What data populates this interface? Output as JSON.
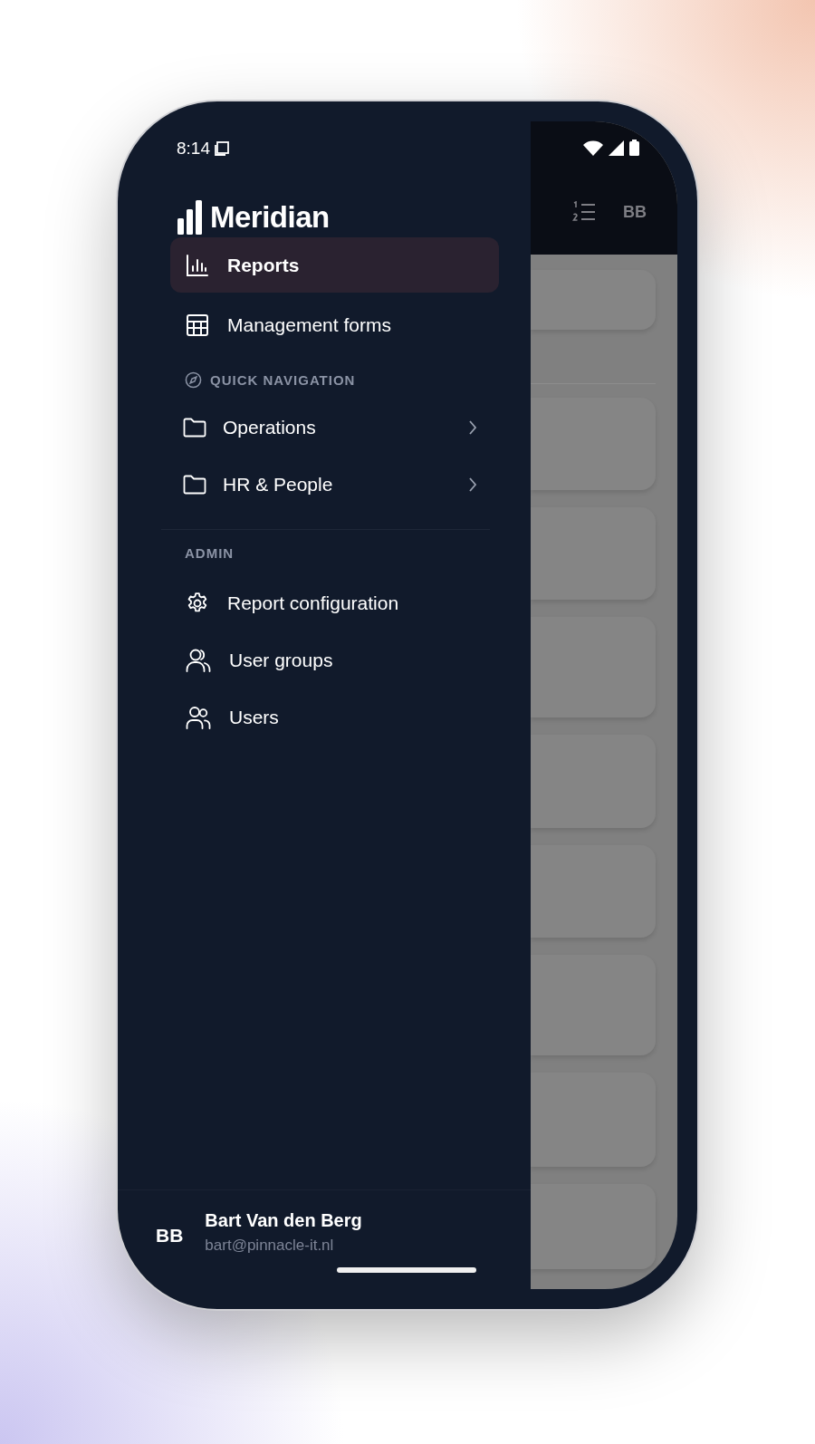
{
  "status_bar": {
    "time": "8:14"
  },
  "drawer": {
    "brand": "Meridian",
    "items": [
      {
        "label": "Reports",
        "kind": "chart",
        "selected": true
      },
      {
        "label": "Management forms",
        "kind": "table",
        "selected": false
      }
    ],
    "quick_navigation": {
      "heading": "QUICK NAVIGATION",
      "folders": [
        {
          "label": "Operations"
        },
        {
          "label": "HR & People"
        }
      ]
    },
    "admin": {
      "heading": "ADMIN",
      "items": [
        {
          "label": "Report configuration",
          "kind": "settings"
        },
        {
          "label": "User groups",
          "kind": "group"
        },
        {
          "label": "Users",
          "kind": "users"
        }
      ]
    },
    "user": {
      "initials": "BB",
      "name": "Bart Van den Berg",
      "email": "bart@pinnacle-it.nl"
    }
  },
  "app_bar": {
    "avatar": "BB"
  }
}
